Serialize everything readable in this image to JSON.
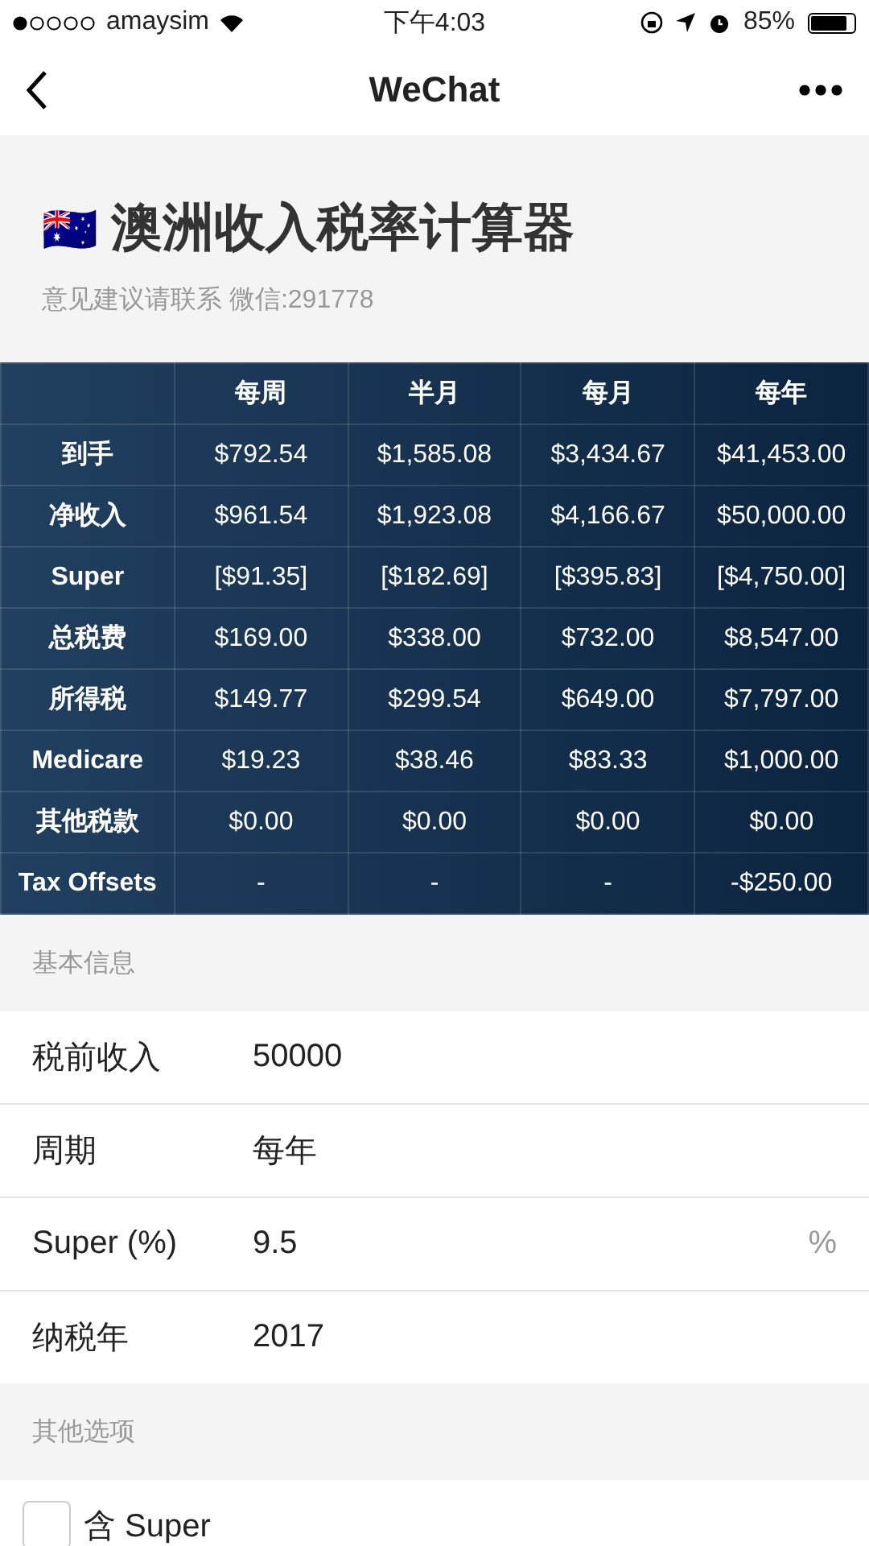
{
  "status_bar": {
    "carrier": "amaysim",
    "time": "下午4:03",
    "battery": "85%"
  },
  "nav": {
    "title": "WeChat"
  },
  "header": {
    "flag": "🇦🇺",
    "title": "澳洲收入税率计算器",
    "subtitle": "意见建议请联系 微信:291778"
  },
  "table": {
    "columns": [
      "每周",
      "半月",
      "每月",
      "每年"
    ],
    "rows": [
      {
        "label": "到手",
        "cells": [
          "$792.54",
          "$1,585.08",
          "$3,434.67",
          "$41,453.00"
        ]
      },
      {
        "label": "净收入",
        "cells": [
          "$961.54",
          "$1,923.08",
          "$4,166.67",
          "$50,000.00"
        ]
      },
      {
        "label": "Super",
        "cells": [
          "[$91.35]",
          "[$182.69]",
          "[$395.83]",
          "[$4,750.00]"
        ]
      },
      {
        "label": "总税费",
        "cells": [
          "$169.00",
          "$338.00",
          "$732.00",
          "$8,547.00"
        ]
      },
      {
        "label": "所得税",
        "cells": [
          "$149.77",
          "$299.54",
          "$649.00",
          "$7,797.00"
        ]
      },
      {
        "label": "Medicare",
        "cells": [
          "$19.23",
          "$38.46",
          "$83.33",
          "$1,000.00"
        ]
      },
      {
        "label": "其他税款",
        "cells": [
          "$0.00",
          "$0.00",
          "$0.00",
          "$0.00"
        ]
      },
      {
        "label": "Tax Offsets",
        "cells": [
          "-",
          "-",
          "-",
          "-$250.00"
        ]
      }
    ]
  },
  "basic_section": {
    "title": "基本信息",
    "fields": [
      {
        "label": "税前收入",
        "value": "50000"
      },
      {
        "label": "周期",
        "value": "每年"
      },
      {
        "label": "Super (%)",
        "value": "9.5",
        "suffix": "%"
      },
      {
        "label": "纳税年",
        "value": "2017"
      }
    ]
  },
  "other_section": {
    "title": "其他选项",
    "options": [
      {
        "label": "含 Super",
        "checked": false
      }
    ]
  }
}
